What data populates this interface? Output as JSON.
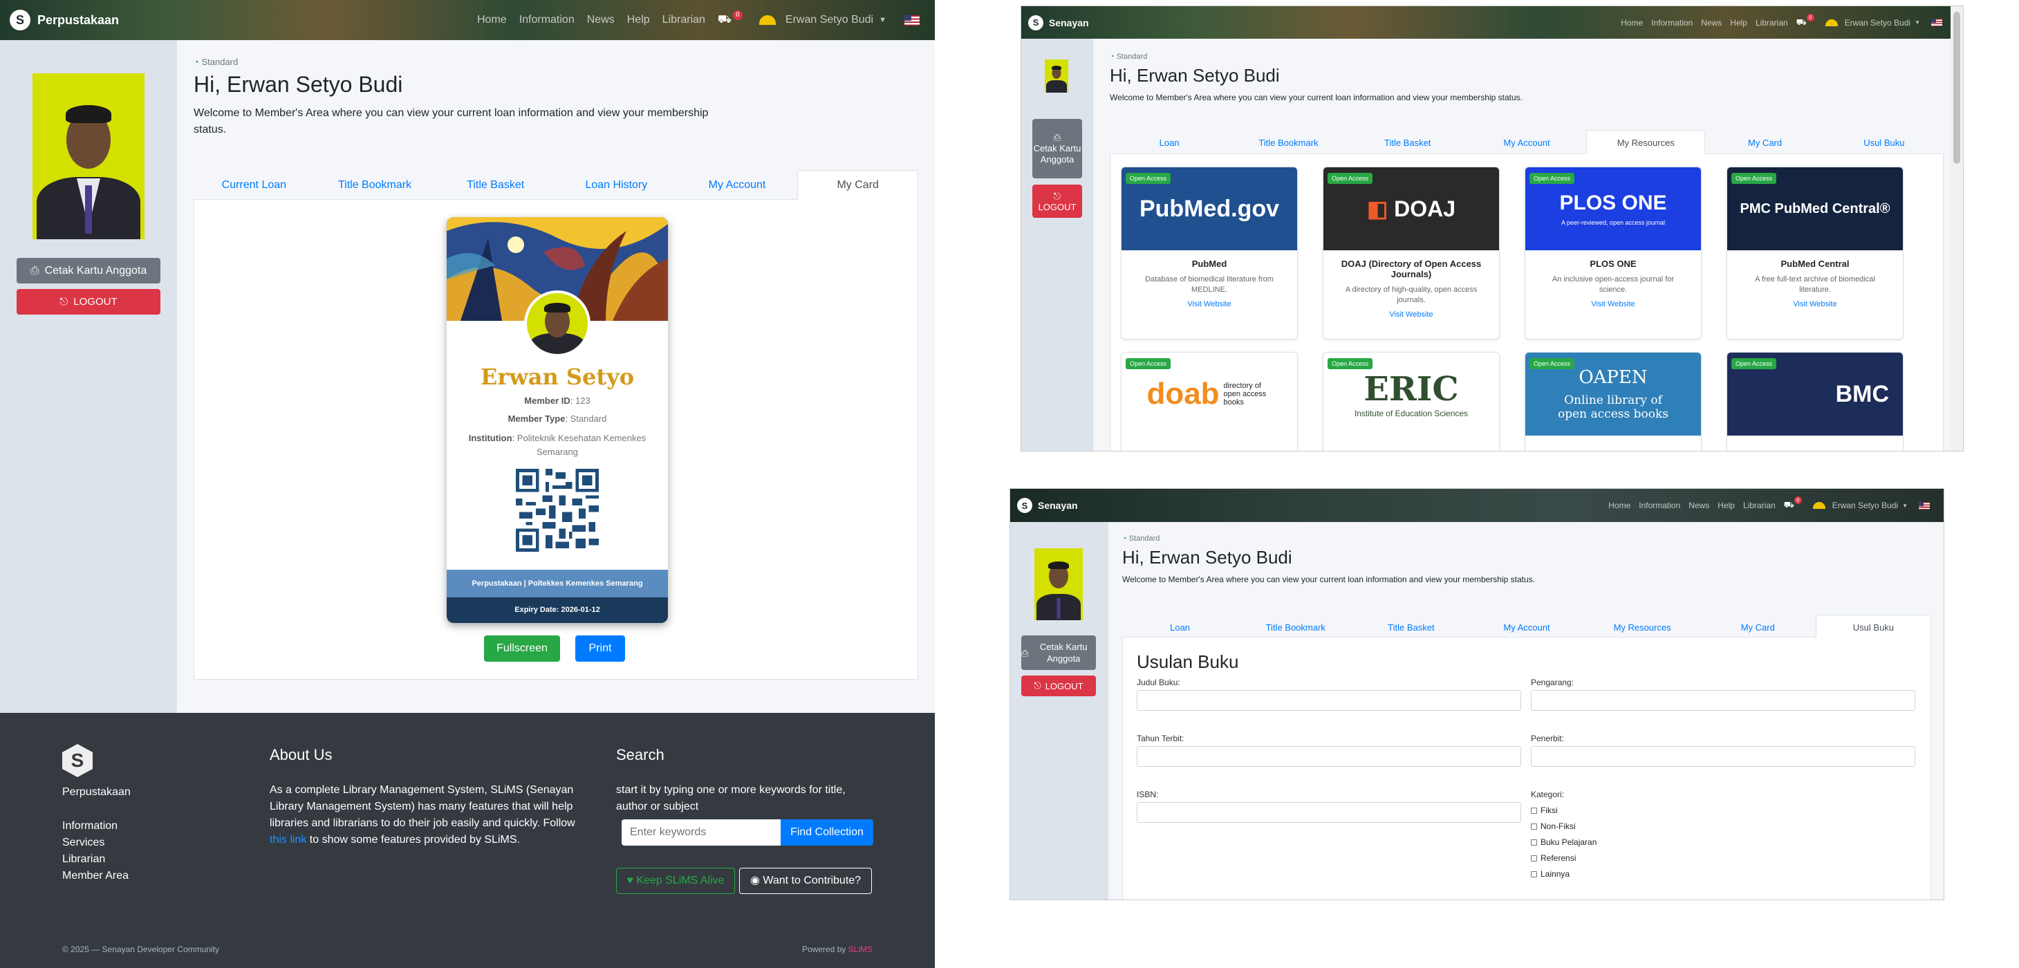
{
  "panel1": {
    "brand": "Perpustakaan",
    "nav": [
      "Home",
      "Information",
      "News",
      "Help",
      "Librarian"
    ],
    "cart_count": "0",
    "user": "Erwan Setyo Budi",
    "print_card_label": "Cetak Kartu Anggota",
    "logout_label": "LOGOUT",
    "member_type_badge": "Standard",
    "greeting": "Hi, Erwan Setyo Budi",
    "welcome": "Welcome to Member's Area where you can view your current loan information and view your membership status.",
    "tabs": [
      "Current Loan",
      "Title Bookmark",
      "Title Basket",
      "Loan History",
      "My Account",
      "My Card"
    ],
    "card": {
      "name": "Erwan Setyo",
      "member_id_label": "Member ID",
      "member_id": "123",
      "member_type_label": "Member Type",
      "member_type": "Standard",
      "institution_label": "Institution",
      "institution": "Politeknik Kesehatan Kemenkes Semarang",
      "library": "Perpustakaan | Poltekkes Kemenkes Semarang",
      "expiry": "Expiry Date: 2026-01-12"
    },
    "fullscreen_label": "Fullscreen",
    "print_label": "Print",
    "footer": {
      "brand": "Perpustakaan",
      "links": [
        "Information",
        "Services",
        "Librarian",
        "Member Area"
      ],
      "about_title": "About Us",
      "about_text_1": "As a complete Library Management System, SLiMS (Senayan Library Management System) has many features that will help libraries and librarians to do their job easily and quickly. Follow ",
      "about_link": "this link",
      "about_text_2": " to show some features provided by SLiMS.",
      "search_title": "Search",
      "search_text": "start it by typing one or more keywords for title, author or subject",
      "search_placeholder": "Enter keywords",
      "find_label": "Find Collection",
      "keep_alive_label": "Keep SLiMS Alive",
      "contribute_label": "Want to Contribute?",
      "copyright": "© 2025 — Senayan Developer Community",
      "powered_by": "Powered by",
      "powered_name": "SLiMS"
    }
  },
  "panel2": {
    "brand": "Senayan",
    "nav": [
      "Home",
      "Information",
      "News",
      "Help",
      "Librarian"
    ],
    "cart_count": "0",
    "user": "Erwan Setyo Budi",
    "print_card_label": "Cetak Kartu Anggota",
    "logout_label": "LOGOUT",
    "member_type_badge": "Standard",
    "greeting": "Hi, Erwan Setyo Budi",
    "welcome": "Welcome to Member's Area where you can view your current loan information and view your membership status.",
    "tabs": [
      "Loan",
      "Title Bookmark",
      "Title Basket",
      "My Account",
      "My Resources",
      "My Card",
      "Usul Buku"
    ],
    "open_access": "Open Access",
    "visit": "Visit Website",
    "resources": [
      {
        "logo": "PubMed.gov",
        "title": "PubMed",
        "desc": "Database of biomedical literature from MEDLINE."
      },
      {
        "logo": "DOAJ",
        "title": "DOAJ (Directory of Open Access Journals)",
        "desc": "A directory of high-quality, open access journals."
      },
      {
        "logo": "PLOS ONE",
        "title": "PLOS ONE",
        "desc": "An inclusive open-access journal for science."
      },
      {
        "logo": "PMC PubMed Central®",
        "title": "PubMed Central",
        "desc": "A free full-text archive of biomedical literature."
      }
    ],
    "row2_logos": [
      "doab",
      "ERIC",
      "OAPEN",
      "BMC"
    ],
    "doab_sub": "directory of open access books",
    "eric_sub": "Institute of Education Sciences",
    "plos_sub": "A peer-reviewed, open access journal",
    "oapen_sub": "Online library of open access books"
  },
  "panel3": {
    "brand": "Senayan",
    "nav": [
      "Home",
      "Information",
      "News",
      "Help",
      "Librarian"
    ],
    "cart_count": "0",
    "user": "Erwan Setyo Budi",
    "print_card_label": "Cetak Kartu Anggota",
    "logout_label": "LOGOUT",
    "member_type_badge": "Standard",
    "greeting": "Hi, Erwan Setyo Budi",
    "welcome": "Welcome to Member's Area where you can view your current loan information and view your membership status.",
    "tabs": [
      "Loan",
      "Title Bookmark",
      "Title Basket",
      "My Account",
      "My Resources",
      "My Card",
      "Usul Buku"
    ],
    "form_title": "Usulan Buku",
    "fields": {
      "judul": "Judul Buku:",
      "pengarang": "Pengarang:",
      "tahun": "Tahun Terbit:",
      "penerbit": "Penerbit:",
      "isbn": "ISBN:",
      "kategori": "Kategori:"
    },
    "kategori_options": [
      "Fiksi",
      "Non-Fiksi",
      "Buku Pelajaran",
      "Referensi",
      "Lainnya"
    ]
  }
}
